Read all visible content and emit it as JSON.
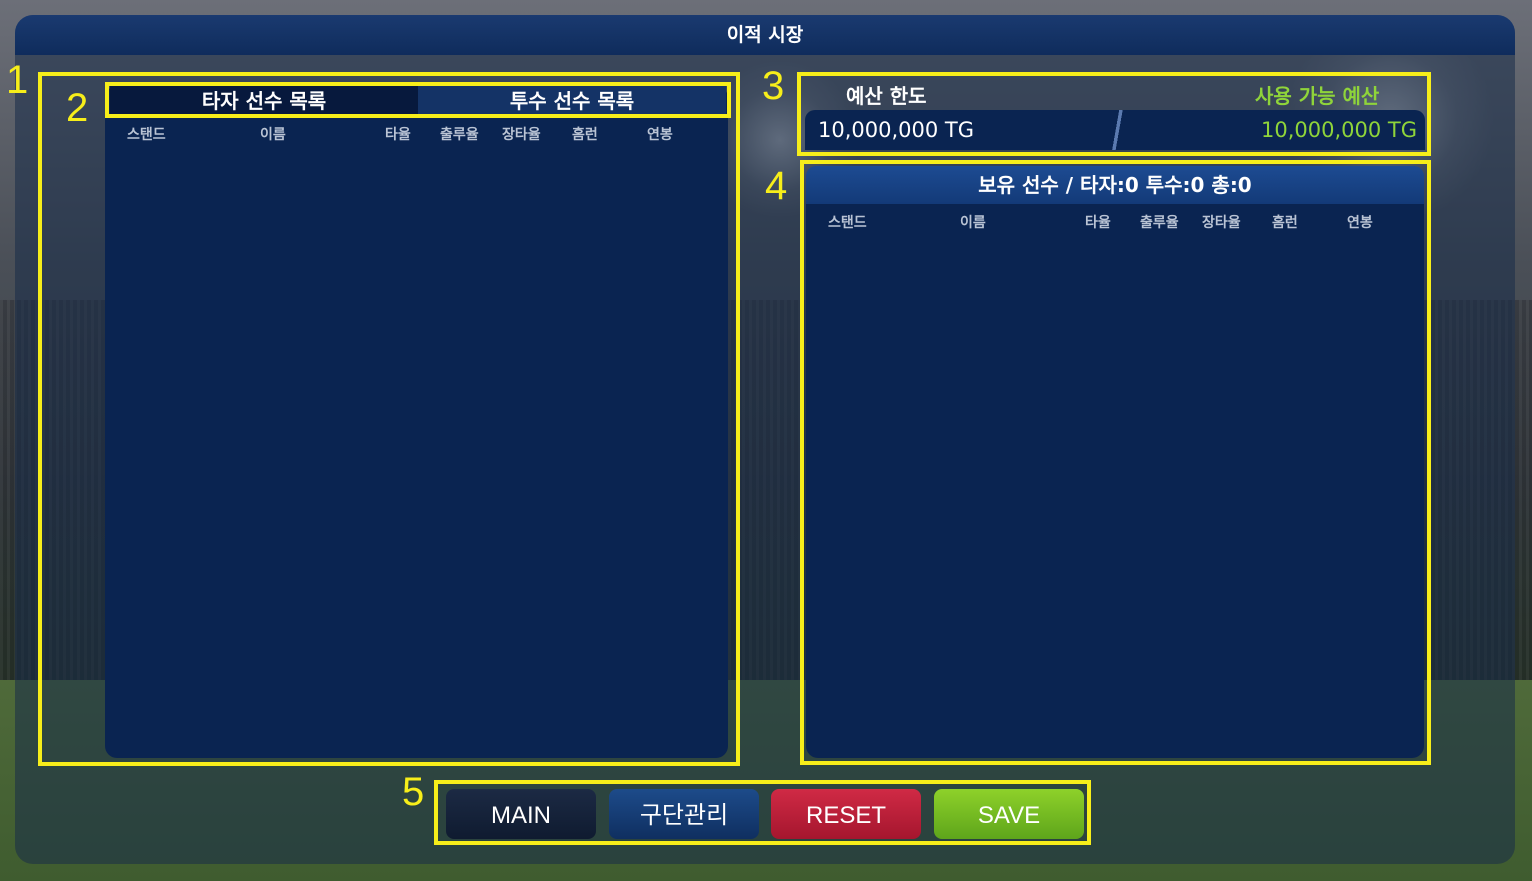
{
  "window": {
    "title": "이적 시장"
  },
  "markers": [
    "1",
    "2",
    "3",
    "4",
    "5"
  ],
  "market": {
    "tabs": [
      {
        "label": "타자 선수 목록",
        "active": true
      },
      {
        "label": "투수 선수 목록",
        "active": false
      }
    ],
    "columns": [
      "스탠드",
      "이름",
      "타율",
      "출루율",
      "장타율",
      "홈런",
      "연봉"
    ]
  },
  "budget": {
    "limit_label": "예산 한도",
    "available_label": "사용 가능 예산",
    "limit_value": "10,000,000 TG",
    "available_value": "10,000,000 TG"
  },
  "owned": {
    "header": "보유 선수 / 타자:0 투수:0 총:0",
    "columns": [
      "스탠드",
      "이름",
      "타율",
      "출루율",
      "장타율",
      "홈런",
      "연봉"
    ]
  },
  "buttons": {
    "main": "MAIN",
    "team": "구단관리",
    "reset": "RESET",
    "save": "SAVE"
  },
  "colors": {
    "highlight": "#f7ee1a",
    "available_budget": "#8fd43a",
    "panel": "#0a2451",
    "reset": "#c0203b",
    "save": "#7cc224"
  }
}
